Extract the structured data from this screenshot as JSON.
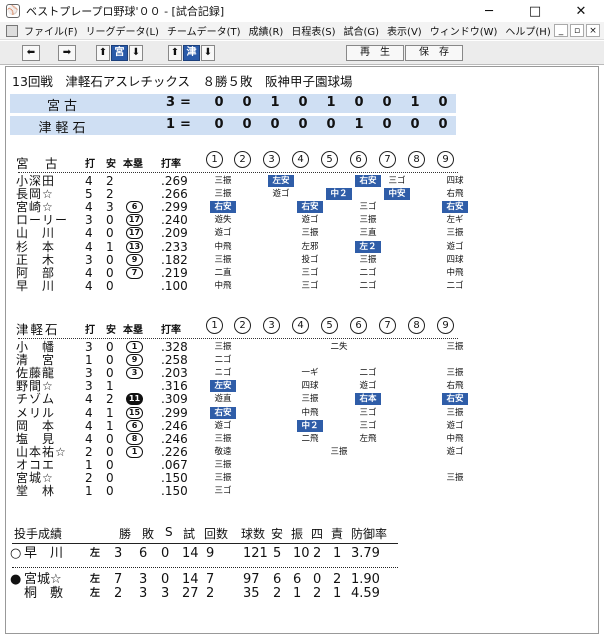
{
  "window": {
    "title": "ベストプレープロ野球'００ - [試合記録]",
    "icon": "baseball-icon",
    "minimize": "─",
    "maximize": "□",
    "close": "✕"
  },
  "menu": [
    {
      "label": "ファイル(F)"
    },
    {
      "label": "リーグデータ(L)"
    },
    {
      "label": "チームデータ(T)"
    },
    {
      "label": "成績(R)"
    },
    {
      "label": "日程表(S)"
    },
    {
      "label": "試合(G)"
    },
    {
      "label": "表示(V)"
    },
    {
      "label": "ウィンドウ(W)"
    },
    {
      "label": "ヘルプ(H)"
    }
  ],
  "mdi_controls": [
    "_",
    "▫",
    "×"
  ],
  "toolbar": {
    "prev": "⬅",
    "next": "➡",
    "team1": "宮",
    "team2": "津",
    "up_arrow": "⬆",
    "down_arrow": "⬇",
    "replay": "再　生",
    "save": "保　存"
  },
  "game_info": "13回戦　津軽石アスレチックス　８勝５敗　阪神甲子園球場",
  "linescore": [
    {
      "team": "宮古",
      "total": "3",
      "eq": "=",
      "innings": [
        "0",
        "0",
        "1",
        "0",
        "1",
        "0",
        "0",
        "1",
        "0"
      ]
    },
    {
      "team": "津軽石",
      "total": "1",
      "eq": "=",
      "innings": [
        "0",
        "0",
        "0",
        "0",
        "0",
        "1",
        "0",
        "0",
        "0"
      ]
    }
  ],
  "batting_headers": {
    "ab": "打",
    "h": "安",
    "hr": "本塁",
    "avg": "打率",
    "innings": [
      "1",
      "2",
      "3",
      "4",
      "5",
      "6",
      "7",
      "8",
      "9"
    ]
  },
  "teams": [
    {
      "name": "宮　古",
      "batters": [
        {
          "name": "小深田",
          "ab": "4",
          "h": "2",
          "hr": "",
          "hr_style": "",
          "avg": ".269",
          "cells": [
            [
              "三振",
              ""
            ],
            [
              "左安",
              "hit"
            ],
            [
              "",
              ""
            ],
            [
              "右安",
              "hit"
            ],
            [
              "三ゴ",
              ""
            ],
            [
              "四球",
              ""
            ]
          ]
        },
        {
          "name": "長岡☆",
          "ab": "5",
          "h": "2",
          "hr": "",
          "hr_style": "",
          "avg": ".266",
          "cells": [
            [
              "三振",
              ""
            ],
            [
              "遊ゴ",
              ""
            ],
            [
              "中２",
              "hit"
            ],
            [
              "中安",
              "hit"
            ],
            [
              "右飛",
              ""
            ]
          ]
        },
        {
          "name": "宮崎☆",
          "ab": "4",
          "h": "3",
          "hr": "6",
          "hr_style": "open",
          "avg": ".299",
          "cells": [
            [
              "右安",
              "hit"
            ],
            [
              "右安",
              "hit"
            ],
            [
              "三ゴ",
              ""
            ],
            [
              "右安",
              "hit"
            ]
          ]
        },
        {
          "name": "ローリー",
          "ab": "3",
          "h": "0",
          "hr": "17",
          "hr_style": "open",
          "avg": ".240",
          "cells": [
            [
              "遊失",
              ""
            ],
            [
              "遊ゴ",
              ""
            ],
            [
              "三振",
              ""
            ],
            [
              "左ギ",
              ""
            ]
          ]
        },
        {
          "name": "山　川",
          "ab": "4",
          "h": "0",
          "hr": "17",
          "hr_style": "open",
          "avg": ".209",
          "cells": [
            [
              "遊ゴ",
              ""
            ],
            [
              "三振",
              ""
            ],
            [
              "三直",
              ""
            ],
            [
              "三振",
              ""
            ]
          ]
        },
        {
          "name": "杉　本",
          "ab": "4",
          "h": "1",
          "hr": "13",
          "hr_style": "open",
          "avg": ".233",
          "cells": [
            [
              "中飛",
              ""
            ],
            [
              "左邪",
              ""
            ],
            [
              "左２",
              "hit"
            ],
            [
              "遊ゴ",
              ""
            ]
          ]
        },
        {
          "name": "正　木",
          "ab": "3",
          "h": "0",
          "hr": "9",
          "hr_style": "open",
          "avg": ".182",
          "cells": [
            [
              "三振",
              ""
            ],
            [
              "投ゴ",
              ""
            ],
            [
              "三振",
              ""
            ],
            [
              "四球",
              ""
            ]
          ]
        },
        {
          "name": "阿　部",
          "ab": "4",
          "h": "0",
          "hr": "7",
          "hr_style": "open",
          "avg": ".219",
          "cells": [
            [
              "二直",
              ""
            ],
            [
              "三ゴ",
              ""
            ],
            [
              "二ゴ",
              ""
            ],
            [
              "中飛",
              ""
            ]
          ]
        },
        {
          "name": "早　川",
          "ab": "4",
          "h": "0",
          "hr": "",
          "hr_style": "",
          "avg": ".100",
          "cells": [
            [
              "中飛",
              ""
            ],
            [
              "三ゴ",
              ""
            ],
            [
              "二ゴ",
              ""
            ],
            [
              "二ゴ",
              ""
            ]
          ]
        }
      ]
    },
    {
      "name": "津軽石",
      "batters": [
        {
          "name": "小　幡",
          "ab": "3",
          "h": "0",
          "hr": "1",
          "hr_style": "open",
          "avg": ".328",
          "cells": [
            [
              "三振",
              ""
            ],
            [
              "二失",
              ""
            ],
            [
              "三振",
              ""
            ]
          ]
        },
        {
          "name": "清　宮",
          "ab": "1",
          "h": "0",
          "hr": "9",
          "hr_style": "open",
          "avg": ".258",
          "cells": [
            [
              "二ゴ",
              ""
            ]
          ]
        },
        {
          "name": "佐藤龍",
          "ab": "3",
          "h": "0",
          "hr": "3",
          "hr_style": "open",
          "avg": ".203",
          "cells": [
            [
              "ニゴ",
              ""
            ],
            [
              "一ギ",
              ""
            ],
            [
              "二ゴ",
              ""
            ],
            [
              "三振",
              ""
            ]
          ]
        },
        {
          "name": "野間☆",
          "ab": "3",
          "h": "1",
          "hr": "",
          "hr_style": "",
          "avg": ".316",
          "cells": [
            [
              "左安",
              "hit"
            ],
            [
              "四球",
              ""
            ],
            [
              "遊ゴ",
              ""
            ],
            [
              "右飛",
              ""
            ]
          ]
        },
        {
          "name": "チゾム",
          "ab": "4",
          "h": "2",
          "hr": "11",
          "hr_style": "filled",
          "avg": ".309",
          "cells": [
            [
              "遊直",
              ""
            ],
            [
              "三振",
              ""
            ],
            [
              "右本",
              "hit"
            ],
            [
              "右安",
              "hit"
            ]
          ]
        },
        {
          "name": "メリル",
          "ab": "4",
          "h": "1",
          "hr": "15",
          "hr_style": "open",
          "avg": ".299",
          "cells": [
            [
              "右安",
              "hit"
            ],
            [
              "中飛",
              ""
            ],
            [
              "三ゴ",
              ""
            ],
            [
              "三振",
              ""
            ]
          ]
        },
        {
          "name": "岡　本",
          "ab": "4",
          "h": "1",
          "hr": "6",
          "hr_style": "open",
          "avg": ".246",
          "cells": [
            [
              "遊ゴ",
              ""
            ],
            [
              "中２",
              "hit"
            ],
            [
              "三ゴ",
              ""
            ],
            [
              "遊ゴ",
              ""
            ]
          ]
        },
        {
          "name": "塩　見",
          "ab": "4",
          "h": "0",
          "hr": "8",
          "hr_style": "open",
          "avg": ".246",
          "cells": [
            [
              "三振",
              ""
            ],
            [
              "二飛",
              ""
            ],
            [
              "左飛",
              ""
            ],
            [
              "中飛",
              ""
            ]
          ]
        },
        {
          "name": "山本祐☆",
          "ab": "2",
          "h": "0",
          "hr": "1",
          "hr_style": "open",
          "avg": ".226",
          "cells": [
            [
              "敬遠",
              ""
            ],
            [
              "三振",
              ""
            ],
            [
              "遊ゴ",
              ""
            ]
          ]
        },
        {
          "name": "オコエ",
          "ab": "1",
          "h": "0",
          "hr": "",
          "hr_style": "",
          "avg": ".067",
          "cells": [
            [
              "三振",
              ""
            ]
          ]
        },
        {
          "name": "宮城☆",
          "ab": "2",
          "h": "0",
          "hr": "",
          "hr_style": "",
          "avg": ".150",
          "cells": [
            [
              "三振",
              ""
            ],
            [
              "三振",
              ""
            ]
          ]
        },
        {
          "name": "堂　林",
          "ab": "1",
          "h": "0",
          "hr": "",
          "hr_style": "",
          "avg": ".150",
          "cells": [
            [
              "三ゴ",
              ""
            ]
          ]
        }
      ]
    }
  ],
  "pitching": {
    "title": "投手成績",
    "headers": [
      "勝",
      "敗",
      "S",
      "試",
      "回数",
      "球数",
      "安",
      "振",
      "四",
      "責",
      "防御率"
    ],
    "pitchers": [
      {
        "mark": "○",
        "name": "早　川",
        "hand": "左",
        "stats": [
          "3",
          "6",
          "0",
          "14",
          "9",
          "121",
          "5",
          "10",
          "2",
          "1",
          "3.79"
        ]
      },
      {
        "mark": "●",
        "name": "宮城☆",
        "hand": "左",
        "stats": [
          "7",
          "3",
          "0",
          "14",
          "7",
          "97",
          "6",
          "6",
          "0",
          "2",
          "1.90"
        ]
      },
      {
        "mark": "",
        "name": "桐　敷",
        "hand": "左",
        "stats": [
          "2",
          "3",
          "3",
          "27",
          "2",
          "35",
          "2",
          "1",
          "2",
          "1",
          "4.59"
        ]
      }
    ]
  }
}
